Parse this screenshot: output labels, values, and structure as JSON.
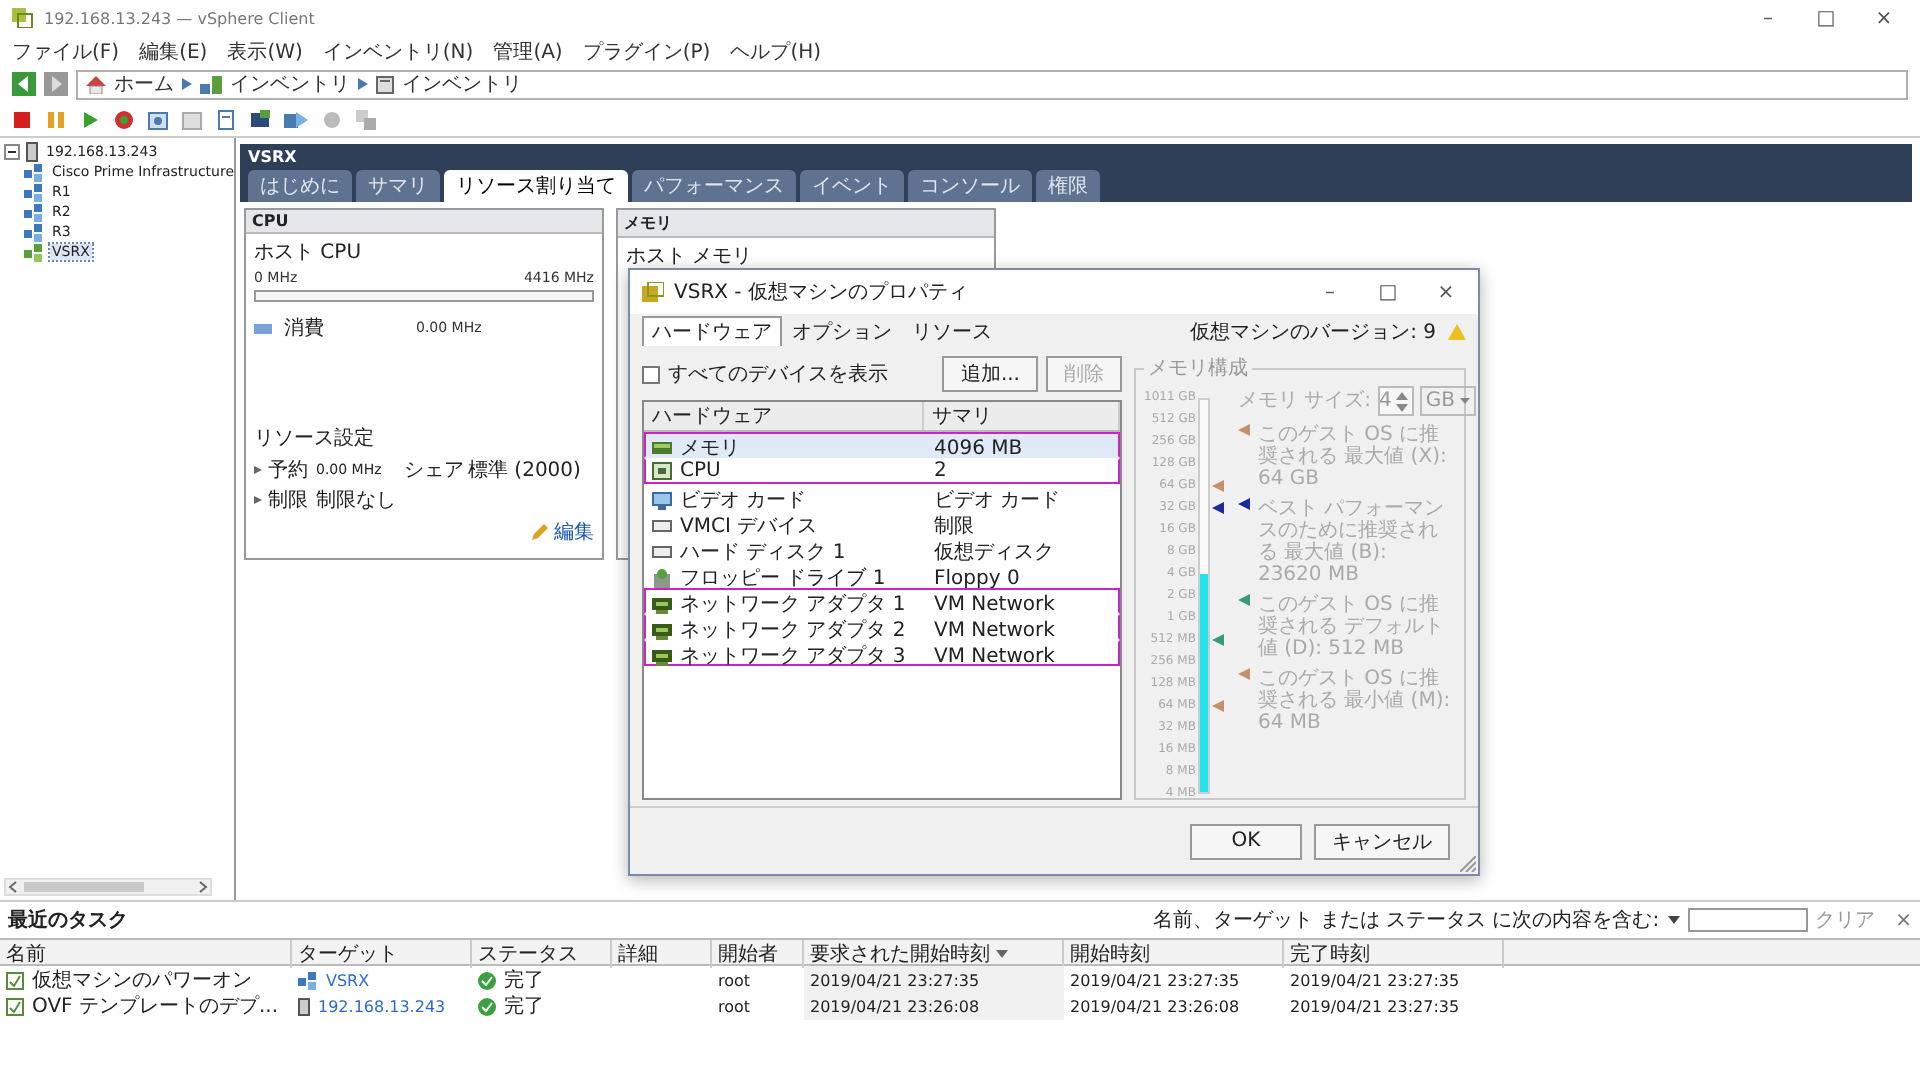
{
  "window": {
    "title": "192.168.13.243 — vSphere Client",
    "controls": [
      "–",
      "□",
      "×"
    ]
  },
  "menu": [
    "ファイル(F)",
    "編集(E)",
    "表示(W)",
    "インベントリ(N)",
    "管理(A)",
    "プラグイン(P)",
    "ヘルプ(H)"
  ],
  "breadcrumb": [
    {
      "label": "ホーム",
      "kind": "home"
    },
    {
      "label": "インベントリ",
      "kind": "inventory"
    },
    {
      "label": "インベントリ",
      "kind": "folder"
    }
  ],
  "tree": {
    "label": "192.168.13.243",
    "expanded": true,
    "children": [
      {
        "label": "Cisco Prime Infrastructure",
        "selected": false,
        "powered_on": false
      },
      {
        "label": "R1",
        "selected": false,
        "powered_on": false
      },
      {
        "label": "R2",
        "selected": false,
        "powered_on": false
      },
      {
        "label": "R3",
        "selected": false,
        "powered_on": false
      },
      {
        "label": "VSRX",
        "selected": true,
        "powered_on": true
      }
    ]
  },
  "content": {
    "title": "VSRX",
    "tabs": [
      {
        "label": "はじめに",
        "selected": false
      },
      {
        "label": "サマリ",
        "selected": false
      },
      {
        "label": "リソース割り当て",
        "selected": true
      },
      {
        "label": "パフォーマンス",
        "selected": false
      },
      {
        "label": "イベント",
        "selected": false
      },
      {
        "label": "コンソール",
        "selected": false
      },
      {
        "label": "権限",
        "selected": false
      }
    ],
    "cpu": {
      "title": "CPU",
      "host_label": "ホスト CPU",
      "min": "0 MHz",
      "max": "4416 MHz",
      "level": 0,
      "legend_label": "消費",
      "legend_value": "0.00 MHz",
      "settings_title": "リソース設定",
      "settings": [
        {
          "label": "予約",
          "value": "0.00 MHz",
          "extra_label": "シェア",
          "extra_value": "標準 (2000)"
        },
        {
          "label": "制限",
          "value": "制限なし"
        }
      ],
      "edit_link": "編集"
    },
    "memory": {
      "title": "メモリ",
      "host_label": "ホスト メモリ"
    }
  },
  "dialog": {
    "title": "VSRX - 仮想マシンのプロパティ",
    "controls": [
      "–",
      "□",
      "×"
    ],
    "tabs": [
      {
        "label": "ハードウェア",
        "selected": true
      },
      {
        "label": "オプション",
        "selected": false
      },
      {
        "label": "リソース",
        "selected": false
      }
    ],
    "version": "仮想マシンのバージョン: 9",
    "show_all": {
      "label": "すべてのデバイスを表示",
      "checked": false
    },
    "buttons": [
      {
        "label": "追加...",
        "disabled": false
      },
      {
        "label": "削除",
        "disabled": true
      }
    ],
    "columns": [
      "ハードウェア",
      "サマリ"
    ],
    "rows": [
      {
        "kind": "memory",
        "name": "メモリ",
        "summary": "4096 MB",
        "selected": true,
        "outlined": true
      },
      {
        "kind": "cpu",
        "name": "CPU",
        "summary": "2",
        "selected": false,
        "outlined": true
      },
      {
        "kind": "video",
        "name": "ビデオ カード",
        "summary": "ビデオ カード",
        "selected": false,
        "outlined": false
      },
      {
        "kind": "device",
        "name": "VMCI デバイス",
        "summary": "制限",
        "selected": false,
        "outlined": false
      },
      {
        "kind": "device",
        "name": "ハード ディスク 1",
        "summary": "仮想ディスク",
        "selected": false,
        "outlined": false
      },
      {
        "kind": "floppy",
        "name": "フロッピー ドライブ 1",
        "summary": "Floppy 0",
        "selected": false,
        "outlined": false
      },
      {
        "kind": "network",
        "name": "ネットワーク アダプタ 1",
        "summary": "VM Network",
        "selected": false,
        "outlined": true
      },
      {
        "kind": "network",
        "name": "ネットワーク アダプタ 2",
        "summary": "VM Network",
        "selected": false,
        "outlined": true
      },
      {
        "kind": "network",
        "name": "ネットワーク アダプタ 3",
        "summary": "VM Network",
        "selected": false,
        "outlined": true
      }
    ],
    "memory_config": {
      "title": "メモリ構成",
      "disabled": true,
      "level": 0.556,
      "size_label": "メモリ サイズ:",
      "size_value": "4",
      "unit": "GB",
      "scale": [
        {
          "label": "1011 GB"
        },
        {
          "label": "512 GB"
        },
        {
          "label": "256 GB"
        },
        {
          "label": "128 GB"
        },
        {
          "label": "64 GB",
          "color": "#c8906a"
        },
        {
          "label": "32 GB",
          "color": "#1c2a9a"
        },
        {
          "label": "16 GB"
        },
        {
          "label": "8 GB"
        },
        {
          "label": "4 GB"
        },
        {
          "label": "2 GB"
        },
        {
          "label": "1 GB"
        },
        {
          "label": "512 MB",
          "color": "#3a9a78"
        },
        {
          "label": "256 MB"
        },
        {
          "label": "128 MB"
        },
        {
          "label": "64 MB",
          "color": "#c8906a"
        },
        {
          "label": "32 MB"
        },
        {
          "label": "16 MB"
        },
        {
          "label": "8 MB"
        },
        {
          "label": "4 MB"
        }
      ],
      "legend": [
        {
          "text": "このゲスト OS に推奨される 最大値 (X): 64 GB",
          "color": "#c8906a"
        },
        {
          "text": "ベスト パフォーマンスのために推奨される 最大値 (B): 23620 MB",
          "color": "#1c2a9a"
        },
        {
          "text": "このゲスト OS に推奨される デフォルト値 (D): 512 MB",
          "color": "#3a9a78"
        },
        {
          "text": "このゲスト OS に推奨される 最小値 (M): 64 MB",
          "color": "#c8906a"
        }
      ]
    },
    "footer_buttons": [
      "OK",
      "キャンセル"
    ]
  },
  "tasks": {
    "title": "最近のタスク",
    "filter_label": "名前、ターゲット または ステータス に次の内容を含む:",
    "clear": "クリア",
    "close": "×",
    "columns": [
      {
        "label": "名前",
        "sorted": false
      },
      {
        "label": "ターゲット",
        "sorted": false
      },
      {
        "label": "ステータス",
        "sorted": false
      },
      {
        "label": "詳細",
        "sorted": false
      },
      {
        "label": "開始者",
        "sorted": false
      },
      {
        "label": "要求された開始時刻",
        "sorted": true
      },
      {
        "label": "開始時刻",
        "sorted": false
      },
      {
        "label": "完了時刻",
        "sorted": false
      }
    ],
    "rows": [
      {
        "name": "仮想マシンのパワーオン",
        "target": "VSRX",
        "kind": "vm",
        "status": "完了",
        "initiator": "root",
        "requested": "2019/04/21 23:27:35",
        "started": "2019/04/21 23:27:35",
        "completed": "2019/04/21 23:27:35"
      },
      {
        "name": "OVF テンプレートのデプ...",
        "target": "192.168.13.243",
        "kind": "host",
        "status": "完了",
        "initiator": "root",
        "requested": "2019/04/21 23:26:08",
        "started": "2019/04/21 23:26:08",
        "completed": "2019/04/21 23:27:35"
      }
    ]
  }
}
